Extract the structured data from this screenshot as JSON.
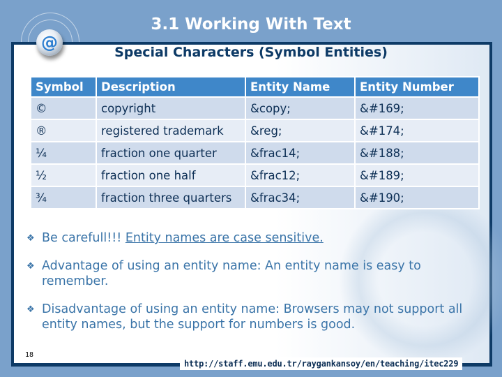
{
  "slide": {
    "title": "3.1 Working With Text",
    "subtitle": "Special Characters (Symbol Entities)",
    "logo_icon": "at-sign-icon",
    "page_number": "18",
    "footer_url": "http://staff.emu.edu.tr/raygankansoy/en/teaching/itec229"
  },
  "table": {
    "headers": [
      "Symbol",
      "Description",
      "Entity Name",
      "Entity Number"
    ],
    "rows": [
      [
        "©",
        "copyright",
        "&copy;",
        "&#169;"
      ],
      [
        "®",
        "registered trademark",
        "&reg;",
        "&#174;"
      ],
      [
        "¼",
        "fraction one quarter",
        "&frac14;",
        "&#188;"
      ],
      [
        "½",
        "fraction one half",
        "&frac12;",
        "&#189;"
      ],
      [
        "¾",
        "fraction three quarters",
        "&frac34;",
        "&#190;"
      ]
    ]
  },
  "bullets": [
    {
      "icon": "diamond-bullet-icon",
      "text": "Be carefull!!! ",
      "underlined": "Entity names are case sensitive."
    },
    {
      "icon": "diamond-bullet-icon",
      "text": "Advantage of using an entity name: An entity name is easy to remember."
    },
    {
      "icon": "diamond-bullet-icon",
      "text": "Disadvantage of using an entity name: Browsers may not support all entity names, but the support for numbers is good."
    }
  ]
}
